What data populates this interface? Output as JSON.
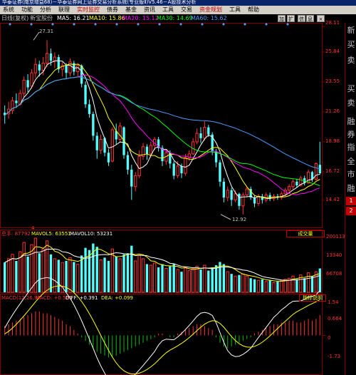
{
  "window": {
    "title": "华泰证券(南京增益68)－华泰证券网上证券交易分析系统(专业版Ⅱ)V5.46－A股技术分析"
  },
  "menu": [
    {
      "label": "系统",
      "active": false
    },
    {
      "label": "功能",
      "active": false
    },
    {
      "label": "分析",
      "active": false
    },
    {
      "label": "联理",
      "active": false
    },
    {
      "label": "实时监控",
      "active": true
    },
    {
      "label": "债券",
      "active": false
    },
    {
      "label": "基金",
      "active": false
    },
    {
      "label": "资讯",
      "active": false
    },
    {
      "label": "工具",
      "active": false
    },
    {
      "label": "交易",
      "active": false
    },
    {
      "label": "资金规划",
      "active": true
    },
    {
      "label": "工具",
      "active": false
    },
    {
      "label": "帮助",
      "active": false
    }
  ],
  "toolbar": {
    "buttons": [
      "加",
      "扩",
      "信",
      "息"
    ],
    "close": "×"
  },
  "info_bar": {
    "period": "日线(复权)",
    "stock": "新宝股份",
    "ma5": "MA5: 16.21",
    "ma10": "MA10: 15.86",
    "ma20": "MA20: 15.12",
    "ma30": "MA30: 14.69",
    "ma60": "MA60: 15.62"
  },
  "price_axis": [
    "28.11",
    "25.84",
    "23.55",
    "21.26",
    "18.98",
    "16.72",
    "14.42"
  ],
  "annotations": {
    "high": "27.31",
    "low": "12.92",
    "marker": "4"
  },
  "volume_bar": {
    "total": "总手: 87792",
    "mavol5": "MAVOL5: 63551",
    "mavol10": "MAVOL10: 53231",
    "button": "成交量"
  },
  "volume_axis": [
    "200113",
    "13340",
    "66708"
  ],
  "macd_bar": {
    "params": "MACD(12,26,9)",
    "macd": "MACD: +0.584",
    "diff": "DIFF: +0.391",
    "dea": "DEA: +0.099",
    "button": "指标说明"
  },
  "macd_axis": [
    "1.54",
    "0.664",
    "0",
    "-1.73"
  ],
  "sidebar": {
    "chars": [
      "新",
      "买",
      "卖",
      "买",
      "卖",
      "融",
      "券",
      "指",
      "全",
      "市",
      "融"
    ],
    "boxes": [
      "1",
      "2"
    ]
  },
  "colors": {
    "up": "#ff3232",
    "down": "#54ffff",
    "ma5": "#ffffff",
    "ma10": "#ffff00",
    "ma20": "#ff00ff",
    "ma30": "#00ff00",
    "ma60": "#4d9cff",
    "grid": "#800000"
  },
  "chart_data": {
    "type": "candlestick",
    "price_ylim": [
      12,
      28.5
    ],
    "candles": [
      [
        21.3,
        21.1,
        21.9,
        20.4
      ],
      [
        21.2,
        21.6,
        22.2,
        20.8
      ],
      [
        21.5,
        22.3,
        22.6,
        21.2
      ],
      [
        22.3,
        22.1,
        22.9,
        21.7
      ],
      [
        22.0,
        22.9,
        23.2,
        21.9
      ],
      [
        22.9,
        24.0,
        24.3,
        22.6
      ],
      [
        24.0,
        23.4,
        24.5,
        23.0
      ],
      [
        23.5,
        24.6,
        24.9,
        23.3
      ],
      [
        24.6,
        25.3,
        25.8,
        24.2
      ],
      [
        25.3,
        24.8,
        25.6,
        24.3
      ],
      [
        24.8,
        25.4,
        25.9,
        24.4
      ],
      [
        25.4,
        26.2,
        27.3,
        25.1
      ],
      [
        26.2,
        25.6,
        26.6,
        25.2
      ],
      [
        25.6,
        25.9,
        26.3,
        25.0
      ],
      [
        25.9,
        24.9,
        26.1,
        24.6
      ],
      [
        24.9,
        25.2,
        25.5,
        24.3
      ],
      [
        25.2,
        24.6,
        25.4,
        24.1
      ],
      [
        24.6,
        25.5,
        25.8,
        24.3
      ],
      [
        25.4,
        24.7,
        25.6,
        24.4
      ],
      [
        24.7,
        25.2,
        25.4,
        24.3
      ],
      [
        25.2,
        23.7,
        25.3,
        23.4
      ],
      [
        23.6,
        22.0,
        23.9,
        21.7
      ],
      [
        22.0,
        21.2,
        22.4,
        20.9
      ],
      [
        21.2,
        19.4,
        21.4,
        19.0
      ],
      [
        19.4,
        18.2,
        19.7,
        17.5
      ],
      [
        18.2,
        19.1,
        19.5,
        17.9
      ],
      [
        19.2,
        18.0,
        19.3,
        17.7
      ],
      [
        18.0,
        17.2,
        18.3,
        16.9
      ],
      [
        17.3,
        19.9,
        20.1,
        17.2
      ],
      [
        19.8,
        19.1,
        20.4,
        18.7
      ],
      [
        19.1,
        20.2,
        20.5,
        18.9
      ],
      [
        20.1,
        17.8,
        20.2,
        17.5
      ],
      [
        17.8,
        16.6,
        18.1,
        16.2
      ],
      [
        16.6,
        15.2,
        17.0,
        14.1
      ],
      [
        15.2,
        16.1,
        16.4,
        14.8
      ],
      [
        16.1,
        17.7,
        18.2,
        15.9
      ],
      [
        17.7,
        18.5,
        18.8,
        17.4
      ],
      [
        18.5,
        17.9,
        18.7,
        17.4
      ],
      [
        17.9,
        18.6,
        18.9,
        17.6
      ],
      [
        18.6,
        19.1,
        19.3,
        18.2
      ],
      [
        19.1,
        18.4,
        19.3,
        18.1
      ],
      [
        18.4,
        17.3,
        18.6,
        16.9
      ],
      [
        17.3,
        18.0,
        18.3,
        17.0
      ],
      [
        18.0,
        17.1,
        18.2,
        16.7
      ],
      [
        17.1,
        16.1,
        17.3,
        15.8
      ],
      [
        16.1,
        16.9,
        17.3,
        15.9
      ],
      [
        16.9,
        16.3,
        17.1,
        15.9
      ],
      [
        16.3,
        17.6,
        17.9,
        16.1
      ],
      [
        17.6,
        17.9,
        18.2,
        17.3
      ],
      [
        17.9,
        18.9,
        19.2,
        17.8
      ],
      [
        18.9,
        19.6,
        20.0,
        18.7
      ],
      [
        19.6,
        19.2,
        20.1,
        18.8
      ],
      [
        19.2,
        20.1,
        20.6,
        19.0
      ],
      [
        20.1,
        19.5,
        20.3,
        19.3
      ],
      [
        19.5,
        18.1,
        19.7,
        17.8
      ],
      [
        18.1,
        17.2,
        18.3,
        16.8
      ],
      [
        17.2,
        15.6,
        17.4,
        15.2
      ],
      [
        15.6,
        14.3,
        15.9,
        13.9
      ],
      [
        14.3,
        14.9,
        15.2,
        14.0
      ],
      [
        14.9,
        14.1,
        15.1,
        13.6
      ],
      [
        14.1,
        14.6,
        14.9,
        13.9
      ],
      [
        14.6,
        13.6,
        14.7,
        13.3
      ],
      [
        13.6,
        14.5,
        14.7,
        12.9
      ],
      [
        14.5,
        15.0,
        15.2,
        14.3
      ],
      [
        15.0,
        14.3,
        15.2,
        14.1
      ],
      [
        14.3,
        13.8,
        14.5,
        13.5
      ],
      [
        13.8,
        14.4,
        14.6,
        13.6
      ],
      [
        14.4,
        14.1,
        14.6,
        13.8
      ],
      [
        14.1,
        14.5,
        14.7,
        13.9
      ],
      [
        14.5,
        14.2,
        14.7,
        14.0
      ],
      [
        14.2,
        14.4,
        14.6,
        14.0
      ],
      [
        14.4,
        14.3,
        14.6,
        14.1
      ],
      [
        14.3,
        14.6,
        14.8,
        14.1
      ],
      [
        14.6,
        14.9,
        15.1,
        14.4
      ],
      [
        14.9,
        15.2,
        15.4,
        14.7
      ],
      [
        15.2,
        15.6,
        15.8,
        15.0
      ],
      [
        15.6,
        15.3,
        15.8,
        15.1
      ],
      [
        15.3,
        15.9,
        16.1,
        15.2
      ],
      [
        15.9,
        15.5,
        16.1,
        15.3
      ],
      [
        15.5,
        16.4,
        16.6,
        15.4
      ],
      [
        16.4,
        15.8,
        16.5,
        15.6
      ],
      [
        15.8,
        17.1,
        17.2,
        15.7
      ],
      [
        17.0,
        16.3,
        18.9,
        16.2
      ]
    ],
    "volume": [
      0.55,
      0.62,
      0.7,
      0.58,
      0.75,
      0.92,
      0.66,
      0.88,
      1.0,
      0.72,
      0.8,
      0.95,
      0.7,
      0.62,
      0.6,
      0.55,
      0.58,
      0.64,
      0.56,
      0.52,
      0.68,
      0.82,
      0.78,
      0.9,
      0.84,
      0.6,
      0.64,
      0.58,
      0.8,
      0.66,
      0.62,
      0.7,
      0.72,
      0.86,
      0.58,
      0.68,
      0.62,
      0.52,
      0.5,
      0.54,
      0.46,
      0.52,
      0.44,
      0.48,
      0.52,
      0.42,
      0.38,
      0.46,
      0.4,
      0.44,
      0.48,
      0.42,
      0.5,
      0.4,
      0.46,
      0.5,
      0.56,
      0.52,
      0.38,
      0.34,
      0.3,
      0.32,
      0.34,
      0.3,
      0.26,
      0.24,
      0.22,
      0.24,
      0.2,
      0.22,
      0.18,
      0.2,
      0.22,
      0.24,
      0.26,
      0.3,
      0.24,
      0.32,
      0.26,
      0.36,
      0.3,
      0.38,
      0.44
    ],
    "macd": {
      "hist": [
        0.5,
        0.6,
        0.7,
        0.8,
        0.9,
        1.0,
        1.1,
        1.2,
        1.3,
        1.3,
        1.2,
        1.2,
        1.1,
        1.0,
        0.9,
        0.8,
        0.6,
        0.5,
        0.3,
        0.1,
        -0.1,
        -0.3,
        -0.5,
        -0.7,
        -0.9,
        -1.0,
        -1.1,
        -1.2,
        -1.2,
        -1.1,
        -1.0,
        -0.9,
        -0.8,
        -0.7,
        -0.6,
        -0.5,
        -0.4,
        -0.3,
        -0.2,
        -0.1,
        0.1,
        0.1,
        0.0,
        -0.1,
        -0.1,
        0.1,
        0.2,
        0.3,
        0.4,
        0.5,
        0.6,
        0.6,
        0.5,
        0.4,
        0.3,
        -0.1,
        -0.4,
        -0.6,
        -0.7,
        -0.6,
        -0.5,
        -0.4,
        -0.3,
        -0.2,
        -0.1,
        0.1,
        0.2,
        0.3,
        0.4,
        0.5,
        0.6,
        0.6,
        0.7,
        0.7,
        0.8,
        0.8,
        0.7,
        0.7,
        0.8,
        0.9,
        0.8,
        0.9,
        1.1
      ],
      "y_range": [
        -2.0,
        1.8
      ]
    }
  }
}
